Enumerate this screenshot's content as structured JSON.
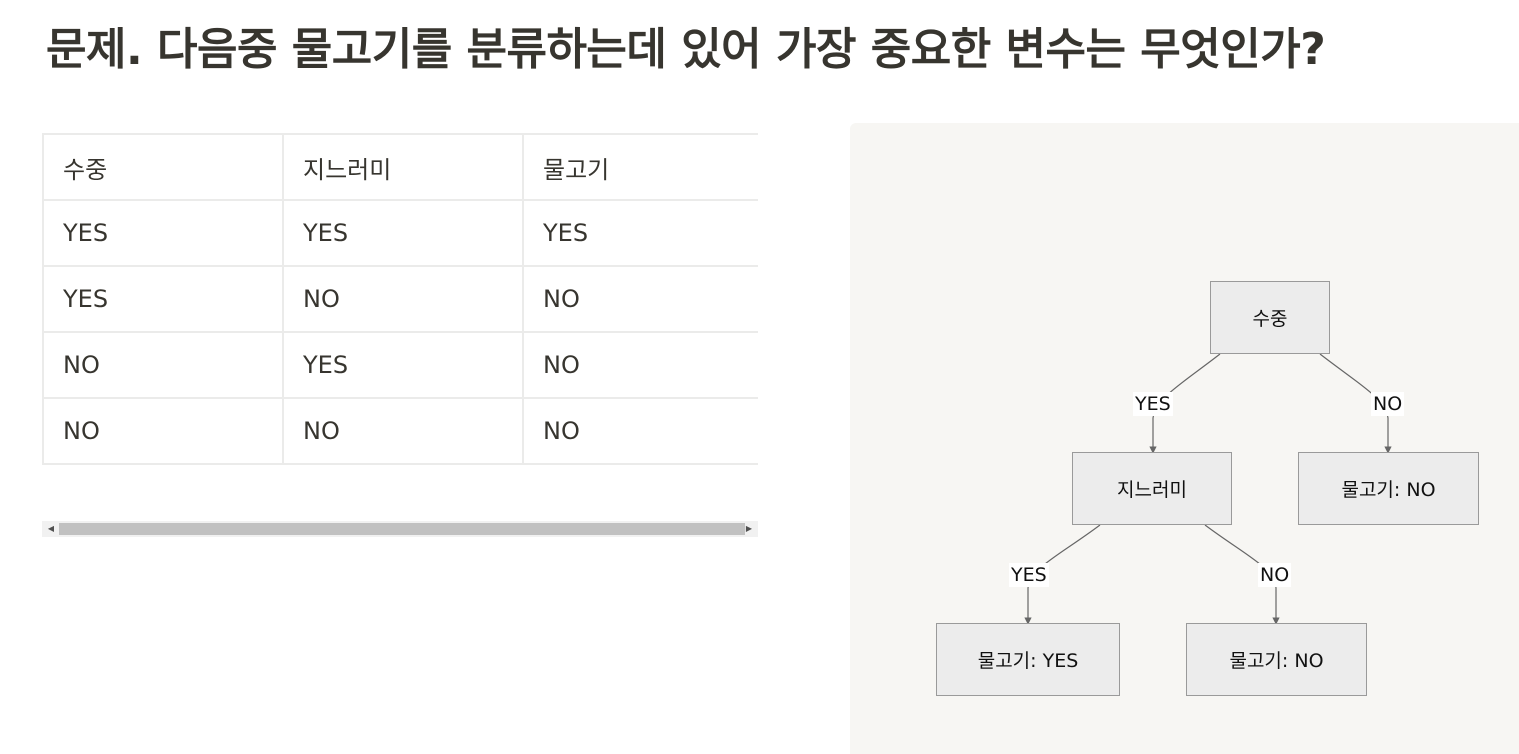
{
  "title": "문제. 다음중 물고기를 분류하는데 있어 가장 중요한 변수는 무엇인가?",
  "table": {
    "rows": [
      [
        "수중",
        "지느러미",
        "물고기"
      ],
      [
        "YES",
        "YES",
        "YES"
      ],
      [
        "YES",
        "NO",
        "NO"
      ],
      [
        "NO",
        "YES",
        "NO"
      ],
      [
        "NO",
        "NO",
        "NO"
      ]
    ]
  },
  "scrollbar": {
    "left_icon": "triangle-left-icon",
    "right_icon": "triangle-right-icon"
  },
  "diagram": {
    "nodes": {
      "root": "수중",
      "fin": "지느러미",
      "root_no": "물고기: NO",
      "fin_yes": "물고기: YES",
      "fin_no": "물고기: NO"
    },
    "edges": {
      "root_yes": "YES",
      "root_no": "NO",
      "fin_yes": "YES",
      "fin_no": "NO"
    }
  },
  "colors": {
    "text": "#37352f",
    "diagram_bg": "#f7f6f3",
    "node_fill": "#ececec",
    "node_border": "#9a9a9a",
    "edge": "#666666"
  }
}
